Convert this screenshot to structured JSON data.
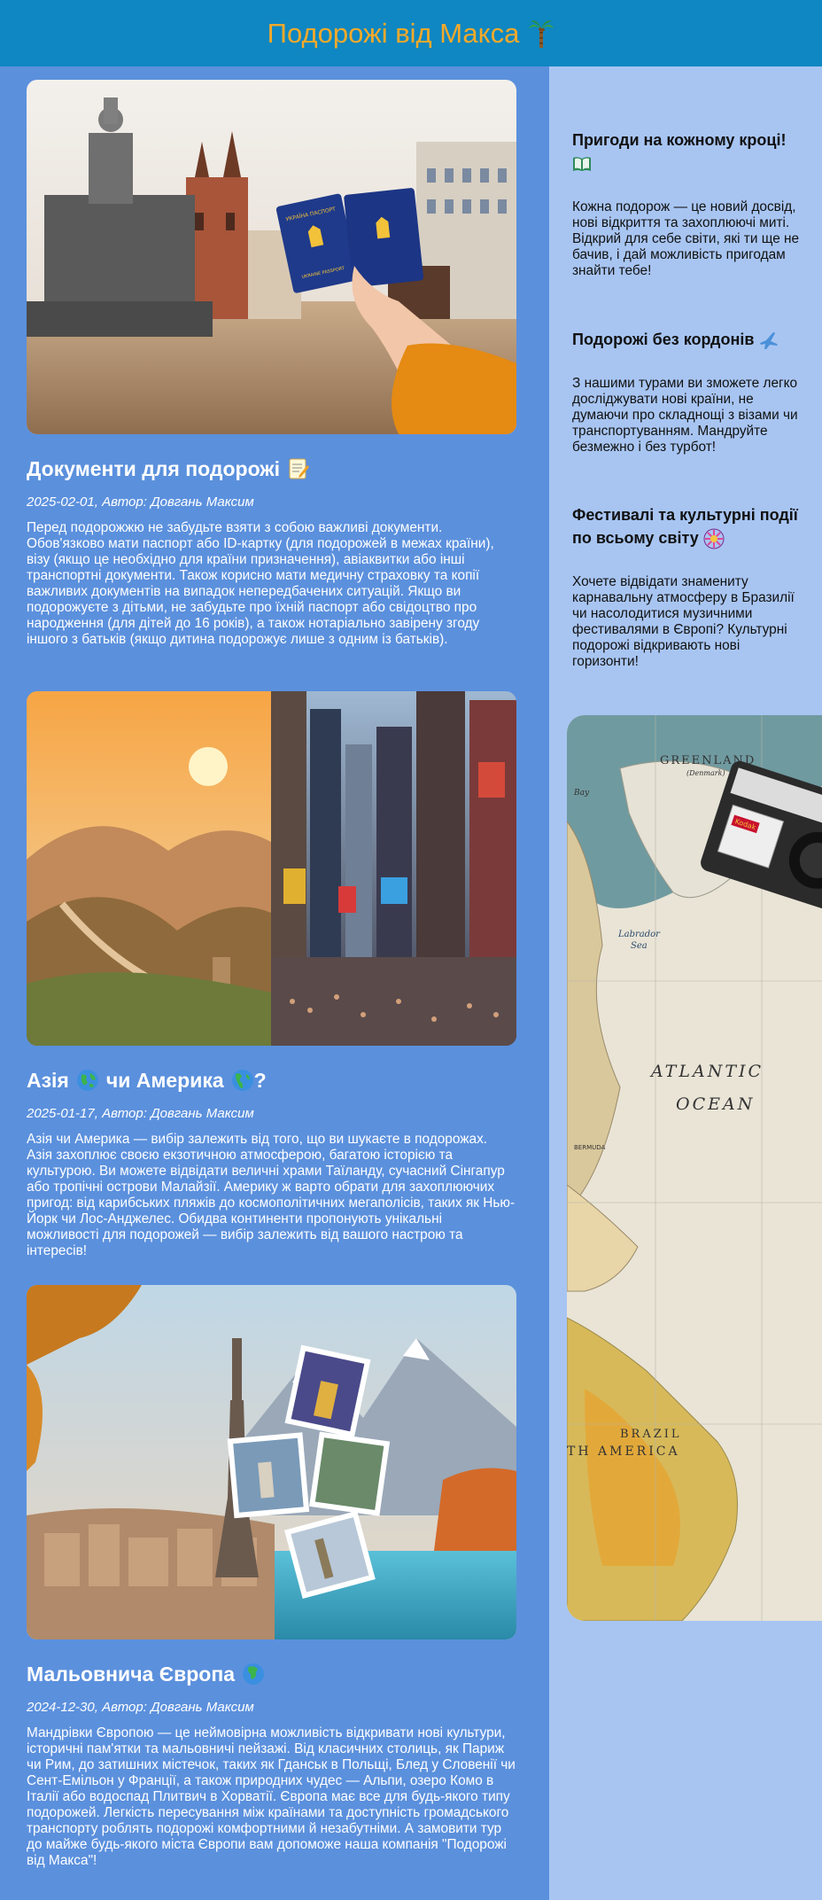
{
  "header": {
    "title": "Подорожі від Макса"
  },
  "posts": [
    {
      "title": "Документи для подорожі",
      "meta": "2025-02-01, Автор: Довгань Максим",
      "text": "Перед подорожжю не забудьте взяти з собою важливі документи. Обов'язково мати паспорт або ID-картку (для подорожей в межах країни), візу (якщо це необхідно для країни призначення), авіаквитки або інші транспортні документи. Також корисно мати медичну страховку та копії важливих документів на випадок непередбачених ситуацій. Якщо ви подорожуєте з дітьми, не забудьте про їхній паспорт або свідоцтво про народження (для дітей до 16 років), а також нотаріально завірену згоду іншого з батьків (якщо дитина подорожує лише з одним із батьків).",
      "passport_label": "УКРАЇНА ПАСПОРТ",
      "passport_label_en": "UKRAINE PASSPORT"
    },
    {
      "title_part1": "Азія",
      "title_part2": "чи Америка",
      "title_part3": "?",
      "meta": "2025-01-17, Автор: Довгань Максим",
      "text": "Азія чи Америка — вибір залежить від того, що ви шукаєте в подорожах. Азія захоплює своєю екзотичною атмосферою, багатою історією та культурою. Ви можете відвідати величні храми Таїланду, сучасний Сінгапур або тропічні острови Малайзії. Америку ж варто обрати для захоплюючих пригод: від карибських пляжів до космополітичних мегаполісів, таких як Нью-Йорк чи Лос-Анджелес. Обидва континенти пропонують унікальні можливості для подорожей — вибір залежить від вашого настрою та інтересів!"
    },
    {
      "title": "Мальовнича Європа",
      "meta": "2024-12-30, Автор: Довгань Максим",
      "text": "Мандрівки Європою — це неймовірна можливість відкривати нові культури, історичні пам'ятки та мальовничі пейзажі. Від класичних столиць, як Париж чи Рим, до затишних містечок, таких як Гданськ в Польщі, Блед у Словенії чи Сент-Емільон у Франції, а також природних чудес — Альпи, озеро Комо в Італії або водоспад Плитвич в Хорватії. Європа має все для будь-якого типу подорожей. Легкість пересування між країнами та доступність громадського транспорту роблять подорожі комфортними й незабутніми. А замовити тур до майже будь-якого міста Європи вам допоможе наша компанія \"Подорожі від Макса\"!"
    }
  ],
  "sidebar": {
    "blocks": [
      {
        "title": "Пригоди на кожному кроці!",
        "text": "Кожна подорож — це новий досвід, нові відкриття та захоплюючі миті. Відкрий для себе світи, які ти ще не бачив, і дай можливість пригодам знайти тебе!"
      },
      {
        "title": "Подорожі без кордонів",
        "text": "З нашими турами ви зможете легко досліджувати нові країни, не думаючи про складнощі з візами чи транспортуванням. Мандруйте безмежно і без турбот!"
      },
      {
        "title": "Фестивалі та культурні події по всьому світу",
        "text": "Хочете відвідати знамениту карнавальну атмосферу в Бразилії чи насолодитися музичними фестивалями в Європі? Культурні подорожі відкривають нові горизонти!"
      }
    ],
    "map_labels": {
      "greenland": "GREENLAND",
      "denmark": "(Denmark)",
      "labrador": "Labrador",
      "labrador_sea": "Sea",
      "atlantic": "ATLANTIC",
      "ocean": "OCEAN",
      "brazil": "BRAZIL",
      "south_america": "TH AMERICA",
      "bay": "Bay",
      "bermuda": "BERMUDA",
      "camera_brand": "Kodak"
    }
  },
  "colors": {
    "header_bg": "#0e87c2",
    "header_title": "#f5a92a",
    "main_bg": "#5b90dd",
    "sidebar_bg": "#a8c5f2"
  },
  "icons": [
    "palm-tree-icon",
    "memo-icon",
    "globe-icon",
    "open-book-icon",
    "airplane-icon",
    "firework-icon"
  ]
}
